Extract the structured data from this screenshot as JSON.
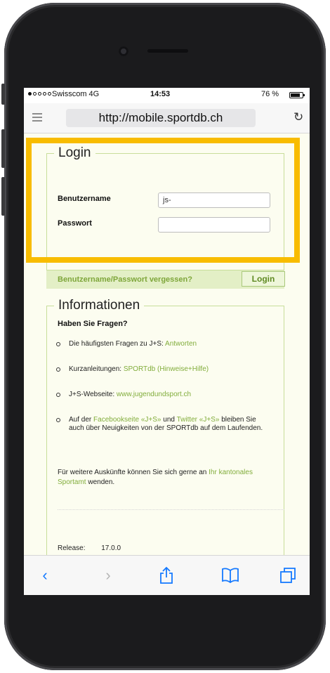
{
  "status_bar": {
    "carrier": "Swisscom 4G",
    "time": "14:53",
    "battery": "76 %"
  },
  "address_bar": {
    "url": "http://mobile.sportdb.ch",
    "menu_icon": "reader-icon",
    "reload_icon": "reload-icon"
  },
  "login": {
    "legend": "Login",
    "username_label": "Benutzername",
    "username_value": "js-",
    "password_label": "Passwort",
    "password_value": "",
    "forgot_link": "Benutzername/Passwort vergessen?",
    "login_button": "Login"
  },
  "info": {
    "legend": "Informationen",
    "heading": "Haben Sie Fragen?",
    "items": [
      {
        "text": "Die häufigsten Fragen zu J+S:",
        "link": "Antworten"
      },
      {
        "text": "Kurzanleitungen:",
        "link": "SPORTdb (Hinweise+Hilfe)"
      },
      {
        "text": "J+S-Webseite:",
        "link": "www.jugendundsport.ch"
      },
      {
        "text_a": "Auf der",
        "link_a": "Facebookseite «J+S»",
        "text_b": "und",
        "link_b": "Twitter «J+S»",
        "text_c": "bleiben Sie auch über Neuigkeiten von der SPORTdb auf dem Laufenden."
      }
    ],
    "paragraph_text": "Für weitere Auskünfte können Sie sich gerne an",
    "paragraph_link": "Ihr kantonales Sportamt",
    "paragraph_end": "wenden.",
    "release_label": "Release:",
    "release_value": "17.0.0"
  },
  "toolbar": {
    "back": "‹",
    "forward": "›",
    "share": "⇪",
    "bookmarks": "⊏⊐",
    "tabs": "❐"
  },
  "colors": {
    "accent_highlight": "#f8bc00",
    "link_green": "#82ad3c",
    "ios_blue": "#1479ff"
  }
}
